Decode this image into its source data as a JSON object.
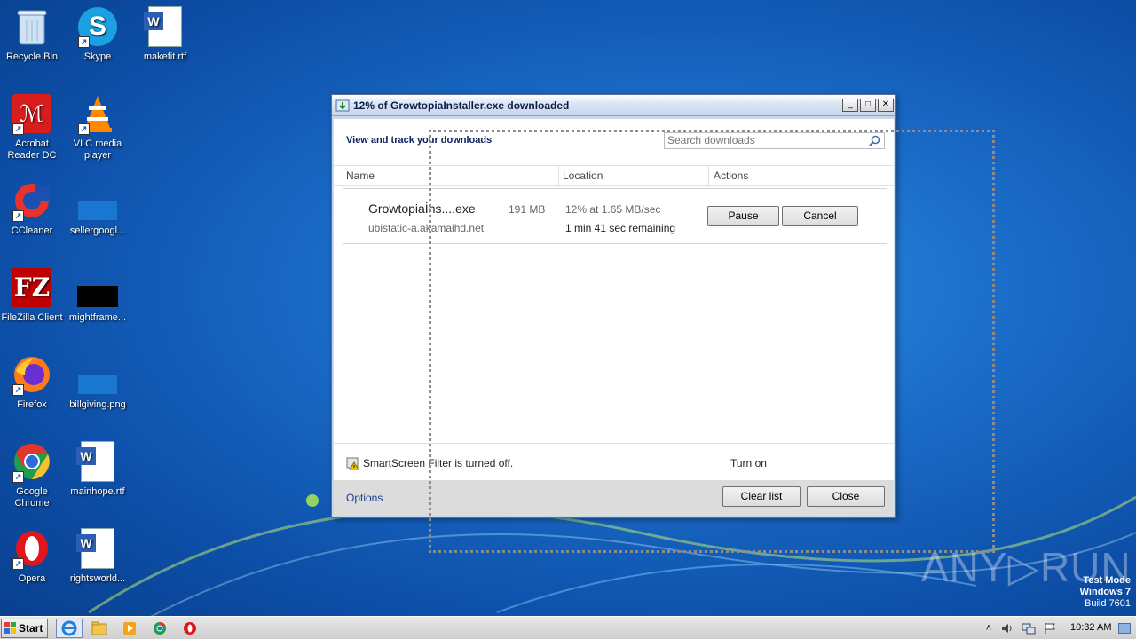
{
  "desktop": {
    "icons": [
      {
        "label": "Recycle Bin"
      },
      {
        "label": "Skype"
      },
      {
        "label": "makefit.rtf"
      },
      {
        "label": "Acrobat Reader DC"
      },
      {
        "label": "VLC media player"
      },
      {
        "label": "CCleaner"
      },
      {
        "label": "sellergoogl..."
      },
      {
        "label": "FileZilla Client"
      },
      {
        "label": "mightframe..."
      },
      {
        "label": "Firefox"
      },
      {
        "label": "billgiving.png"
      },
      {
        "label": "Google Chrome"
      },
      {
        "label": "mainhope.rtf"
      },
      {
        "label": "Opera"
      },
      {
        "label": "rightsworld..."
      }
    ]
  },
  "window": {
    "title": "12% of GrowtopiaInstaller.exe downloaded",
    "heading": "View and track your downloads",
    "search_placeholder": "Search downloads",
    "columns": {
      "name": "Name",
      "location": "Location",
      "actions": "Actions"
    },
    "download": {
      "filename": "Growtopiaİns....exe",
      "size": "191 MB",
      "source": "ubistatic-a.akamaihd.net",
      "progress": "12% at 1.65 MB/sec",
      "remaining": "1 min 41 sec remaining",
      "pause_label": "Pause",
      "cancel_label": "Cancel"
    },
    "smartscreen": {
      "text": "SmartScreen Filter is turned off.",
      "link": "Turn on"
    },
    "footer": {
      "options": "Options",
      "clear_list": "Clear list",
      "close": "Close"
    }
  },
  "watermark": "ANY▷RUN",
  "test_mode": {
    "line1": "Test Mode",
    "line2": "Windows 7",
    "line3": "Build 7601"
  },
  "taskbar": {
    "start_label": "Start",
    "time": "10:32 AM"
  }
}
